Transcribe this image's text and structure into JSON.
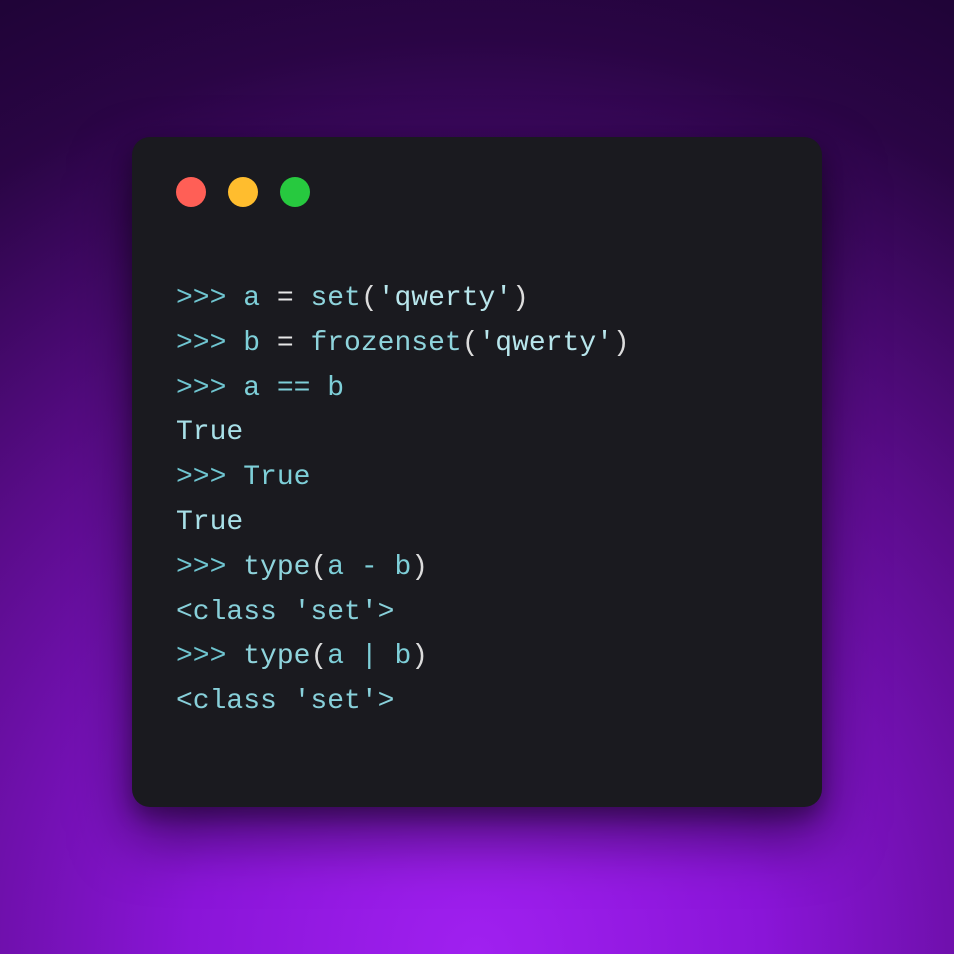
{
  "traffic_lights": {
    "red": "#ff5f56",
    "yellow": "#ffbd2e",
    "green": "#27c93f"
  },
  "code": {
    "prompt": ">>> ",
    "line1": {
      "prompt": ">>> ",
      "var": "a",
      "eq": " = ",
      "func": "set",
      "open": "(",
      "str": "'qwerty'",
      "close": ")"
    },
    "line2": {
      "prompt": ">>> ",
      "var": "b",
      "eq": " = ",
      "func": "frozenset",
      "open": "(",
      "str": "'qwerty'",
      "close": ")"
    },
    "line3": {
      "prompt": ">>> ",
      "expr": "a == b"
    },
    "line4": "True",
    "line5": {
      "prompt": ">>> ",
      "expr": "True"
    },
    "line6": "True",
    "line7": {
      "prompt": ">>> ",
      "func": "type",
      "open": "(",
      "expr": "a - b",
      "close": ")"
    },
    "line8": "<class 'set'>",
    "line9": {
      "prompt": ">>> ",
      "func": "type",
      "open": "(",
      "expr": "a | b",
      "close": ")"
    },
    "line10": "<class 'set'>"
  }
}
